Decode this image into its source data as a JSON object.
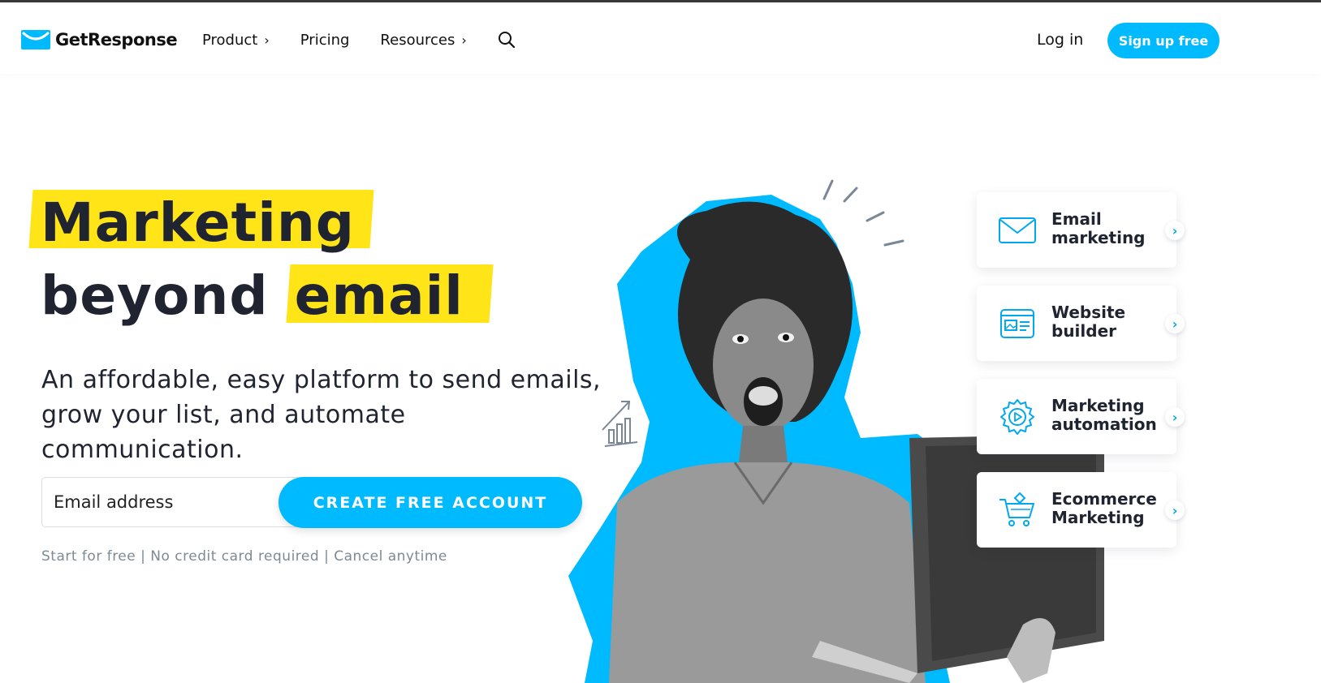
{
  "brand": {
    "name": "GetResponse",
    "accent_color": "#00baff",
    "highlight_color": "#ffe418"
  },
  "nav": {
    "items": [
      {
        "label": "Product",
        "has_chevron": true
      },
      {
        "label": "Pricing",
        "has_chevron": false
      },
      {
        "label": "Resources",
        "has_chevron": true
      }
    ],
    "chevron": "›",
    "search_icon": "search-icon",
    "login_label": "Log in",
    "signup_label": "Sign up free"
  },
  "hero": {
    "headline_line1": "Marketing",
    "headline_line2_a": "beyond",
    "headline_line2_b": "email",
    "subheading": "An affordable, easy platform to send emails, grow your list, and automate communication.",
    "email_placeholder": "Email address",
    "cta_label": "CREATE FREE ACCOUNT",
    "fineprint": "Start for free | No credit card required | Cancel anytime"
  },
  "features": [
    {
      "label": "Email marketing",
      "icon": "envelope-icon"
    },
    {
      "label": "Website builder",
      "icon": "website-icon"
    },
    {
      "label": "Marketing automation",
      "icon": "automation-gear-icon"
    },
    {
      "label": "Ecommerce Marketing",
      "icon": "shopping-cart-icon"
    }
  ],
  "feature_arrow": "›"
}
